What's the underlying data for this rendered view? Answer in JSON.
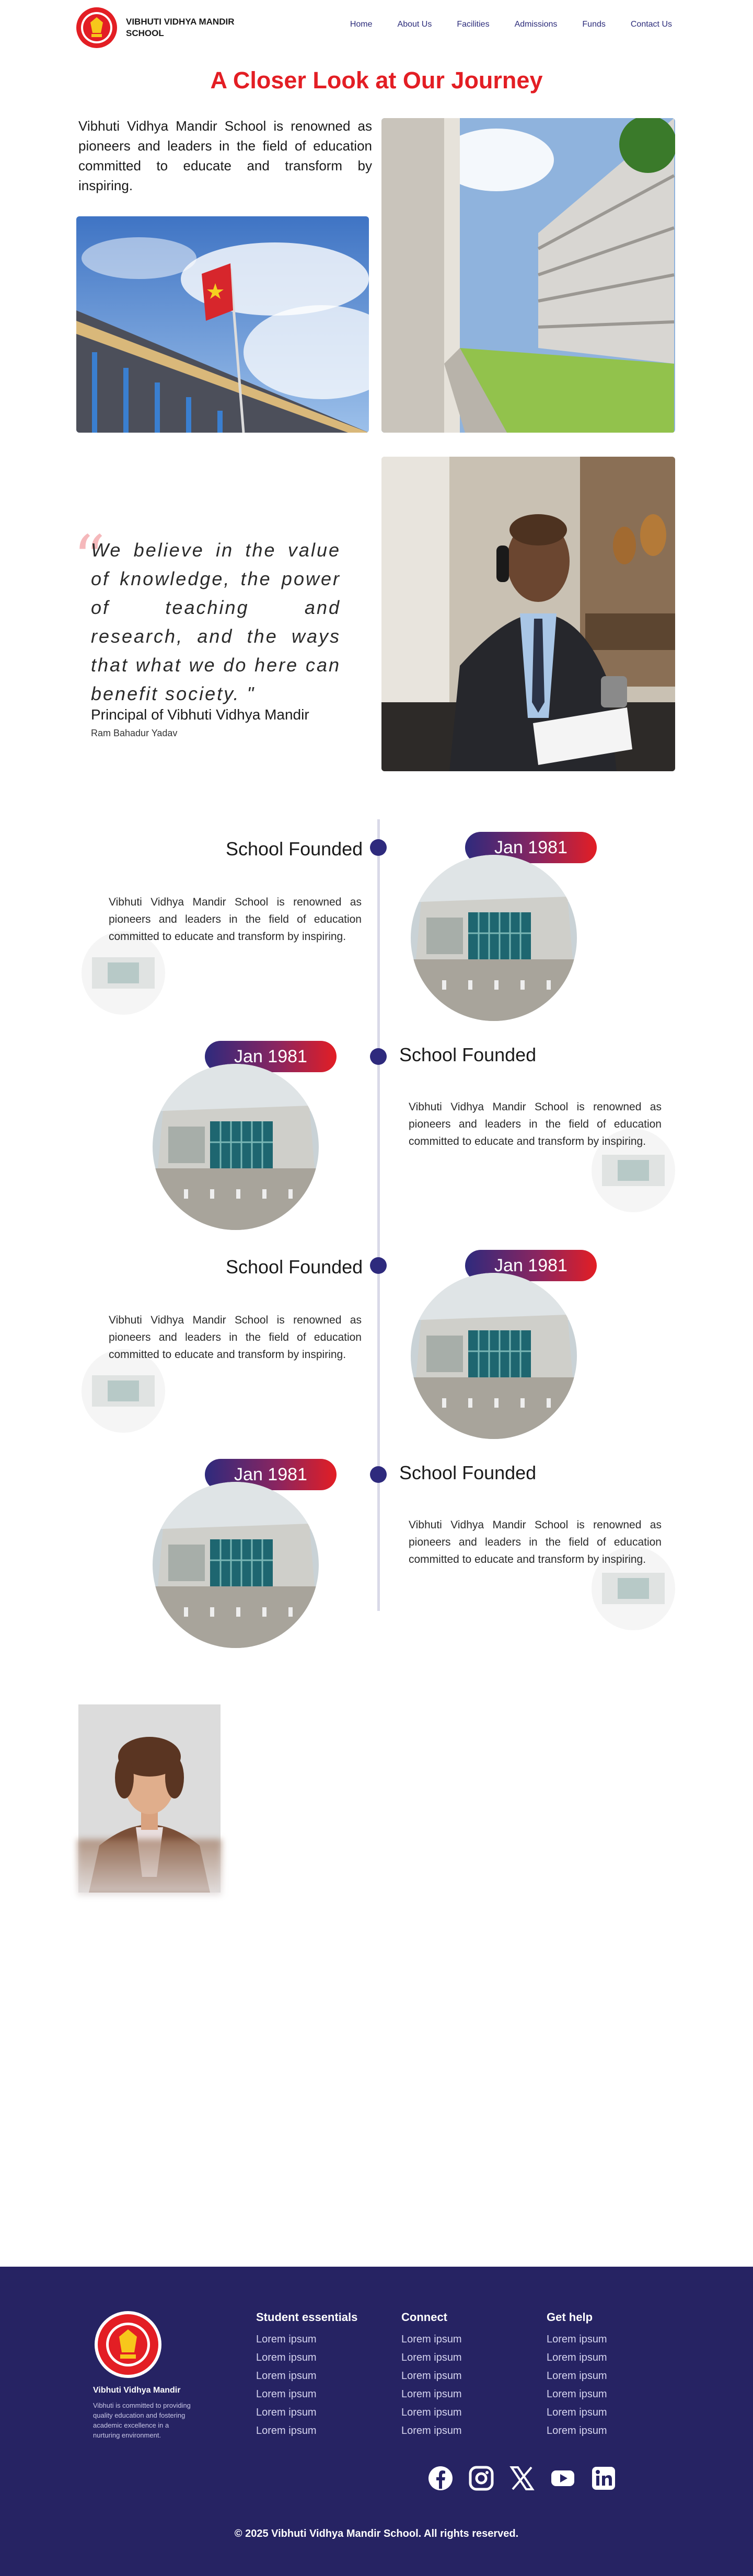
{
  "header": {
    "brand": "VIBHUTI VIDHYA MANDIR SCHOOL",
    "nav": [
      "Home",
      "About Us",
      "Facilities",
      "Admissions",
      "Funds",
      "Contact Us"
    ]
  },
  "intro": {
    "title": "A Closer Look at Our Journey",
    "text": "Vibhuti Vidhya Mandir School is renowned as pioneers and leaders in the field of education committed to educate and transform by inspiring."
  },
  "quote": {
    "text": "We believe in the value of knowledge, the power of teaching and research, and the ways that what we do here can benefit society. \"",
    "principal_title": "Principal of Vibhuti Vidhya Mandir",
    "principal_name": "Ram Bahadur Yadav"
  },
  "timeline": [
    {
      "heading": "School Founded",
      "date": "Jan 1981",
      "text": "Vibhuti Vidhya Mandir School is renowned as pioneers and leaders in the field of education committed to educate and transform by inspiring."
    },
    {
      "heading": "School Founded",
      "date": "Jan 1981",
      "text": "Vibhuti Vidhya Mandir School is renowned as pioneers and leaders in the field of education committed to educate and transform by inspiring."
    },
    {
      "heading": "School Founded",
      "date": "Jan 1981",
      "text": "Vibhuti Vidhya Mandir School is renowned as pioneers and leaders in the field of education committed to educate and transform by inspiring."
    },
    {
      "heading": "School Founded",
      "date": "Jan 1981",
      "text": "Vibhuti Vidhya Mandir School is renowned as pioneers and leaders in the field of education committed to educate and transform by inspiring."
    }
  ],
  "footer": {
    "school_name": "Vibhuti Vidhya Mandir",
    "description": "Vibhuti is committed to providing quality education and fostering academic excellence in a nurturing environment.",
    "columns": [
      {
        "title": "Student essentials",
        "links": [
          "Lorem ipsum",
          "Lorem ipsum",
          "Lorem ipsum",
          "Lorem ipsum",
          "Lorem ipsum",
          "Lorem ipsum"
        ]
      },
      {
        "title": "Connect",
        "links": [
          "Lorem ipsum",
          "Lorem ipsum",
          "Lorem ipsum",
          "Lorem ipsum",
          "Lorem ipsum",
          "Lorem ipsum"
        ]
      },
      {
        "title": "Get help",
        "links": [
          "Lorem ipsum",
          "Lorem ipsum",
          "Lorem ipsum",
          "Lorem ipsum",
          "Lorem ipsum",
          "Lorem ipsum"
        ]
      }
    ],
    "socials": [
      "facebook-icon",
      "instagram-icon",
      "x-icon",
      "youtube-icon",
      "linkedin-icon"
    ],
    "copyright": "© 2025 Vibhuti Vidhya Mandir School. All rights reserved."
  },
  "colors": {
    "accent_red": "#e31e24",
    "navy": "#2e2a7d",
    "footer_bg": "#262363"
  }
}
